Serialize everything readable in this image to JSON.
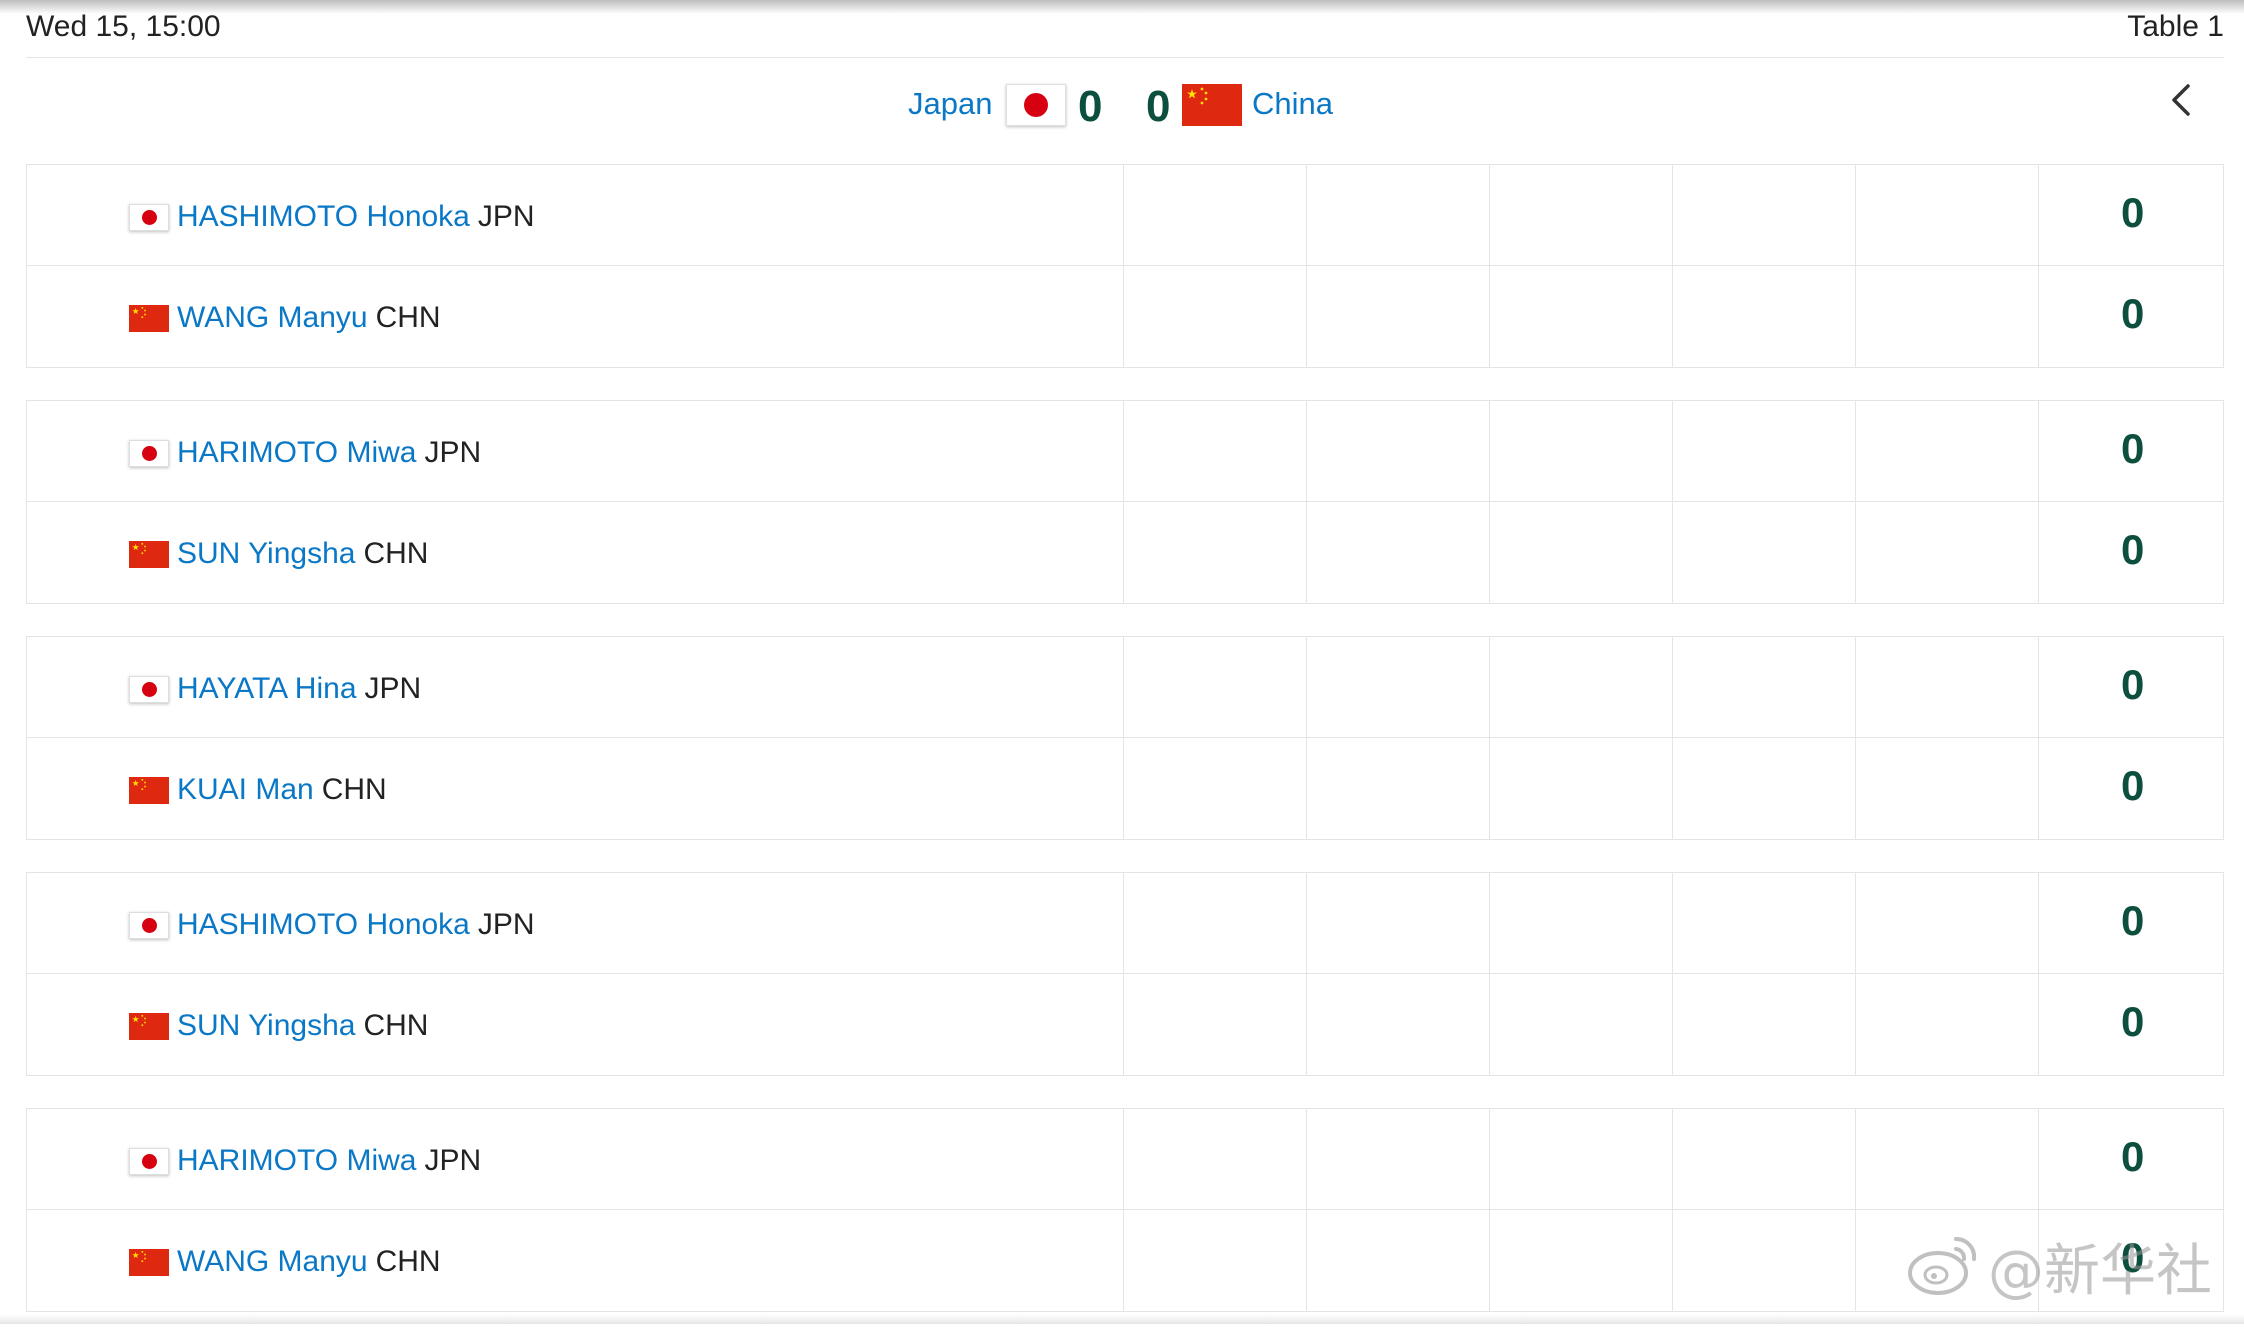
{
  "top_bar": {
    "datetime": "Wed 15, 15:00",
    "table": "Table 1"
  },
  "match": {
    "team_a": {
      "name": "Japan",
      "flag": "japan-flag",
      "score": "0"
    },
    "team_b": {
      "name": "China",
      "flag": "china-flag",
      "score": "0"
    },
    "back_icon": "chevron-left-icon"
  },
  "games": [
    {
      "players": [
        {
          "name": "HASHIMOTO Honoka",
          "code": "JPN",
          "flag": "jp",
          "score": "0"
        },
        {
          "name": "WANG Manyu",
          "code": "CHN",
          "flag": "cn",
          "score": "0"
        }
      ]
    },
    {
      "players": [
        {
          "name": "HARIMOTO Miwa",
          "code": "JPN",
          "flag": "jp",
          "score": "0"
        },
        {
          "name": "SUN Yingsha",
          "code": "CHN",
          "flag": "cn",
          "score": "0"
        }
      ]
    },
    {
      "players": [
        {
          "name": "HAYATA Hina",
          "code": "JPN",
          "flag": "jp",
          "score": "0"
        },
        {
          "name": "KUAI Man",
          "code": "CHN",
          "flag": "cn",
          "score": "0"
        }
      ]
    },
    {
      "players": [
        {
          "name": "HASHIMOTO Honoka",
          "code": "JPN",
          "flag": "jp",
          "score": "0"
        },
        {
          "name": "SUN Yingsha",
          "code": "CHN",
          "flag": "cn",
          "score": "0"
        }
      ]
    },
    {
      "players": [
        {
          "name": "HARIMOTO Miwa",
          "code": "JPN",
          "flag": "jp",
          "score": "0"
        },
        {
          "name": "WANG Manyu",
          "code": "CHN",
          "flag": "cn",
          "score": "0"
        }
      ]
    }
  ],
  "watermark": {
    "text": "@新华社",
    "icon": "weibo-icon"
  },
  "colors": {
    "link_blue": "#0a78c6",
    "score_green": "#0d4f3e",
    "japan_red": "#d60011",
    "china_red": "#de2910",
    "china_star": "#ffde00",
    "border": "#e4e4e4"
  }
}
